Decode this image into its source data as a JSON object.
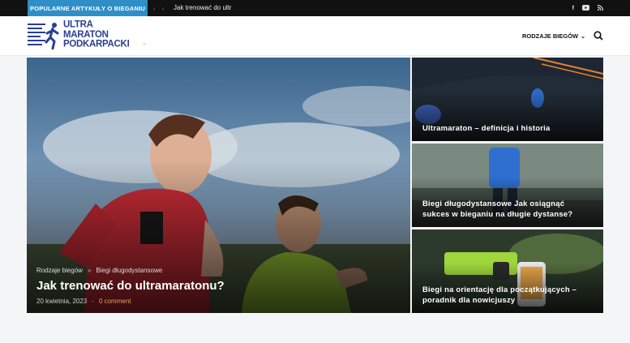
{
  "topbar": {
    "label": "POPULARNE ARTYKUŁY O BIEGANIU",
    "prev_icon": "chevron-left-icon",
    "next_icon": "chevron-right-icon",
    "ticker": "Jak trenować do ultr",
    "social": [
      "facebook-icon",
      "youtube-icon",
      "rss-icon"
    ]
  },
  "header": {
    "logo_lines": [
      "ULTRA",
      "MARATON",
      "PODKARPACKI"
    ],
    "menu_item": "RODZAJE BIEGÓW",
    "search_icon": "search-icon",
    "brand_color": "#2b3f8f"
  },
  "featured": {
    "category1": "Rodzaje biegów",
    "category2": "Biegi długodystansowe",
    "title": "Jak trenować do ultramaratonu?",
    "date": "20 kwietnia, 2023",
    "comments": "0 comment"
  },
  "cards": [
    {
      "title_line1": "Ultramaraton – definicja i historia",
      "title_line2": ""
    },
    {
      "title_line1": "Biegi długodystansowe Jak osiągnąć",
      "title_line2": "sukces w bieganiu na długie dystanse?"
    },
    {
      "title_line1": "Biegi na orientację dla początkujących –",
      "title_line2": "poradnik dla nowicjuszy"
    }
  ],
  "colors": {
    "accent": "#2e8fc8",
    "comment": "#e8a05c"
  }
}
